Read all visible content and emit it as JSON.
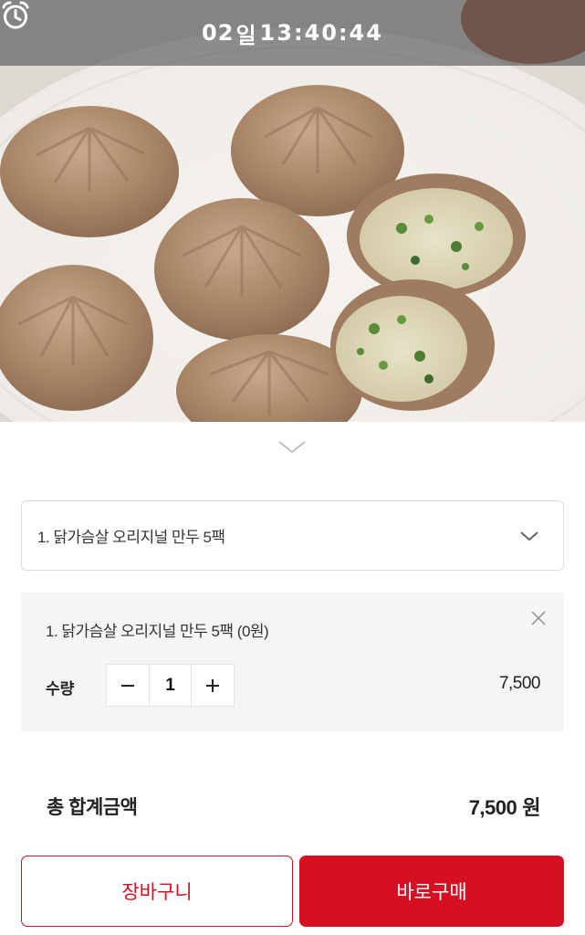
{
  "timer": {
    "icon": "alarm-clock-icon",
    "day": "02",
    "day_unit": "일",
    "time": "13:40:44"
  },
  "product_image": {
    "icon": "product-photo-dumplings"
  },
  "collapse": {
    "icon": "chevron-down-icon"
  },
  "option_select": {
    "selected_label": "1. 닭가슴살 오리지널 만두 5팩",
    "icon": "chevron-down-icon"
  },
  "selected_option": {
    "name": "1. 닭가슴살 오리지널 만두 5팩 (0원)",
    "remove_icon": "close-icon",
    "quantity_label": "수량",
    "quantity": "1",
    "decrement": "−",
    "increment": "+",
    "price": "7,500"
  },
  "total": {
    "label": "총 합계금액",
    "amount": "7,500",
    "currency": "원"
  },
  "actions": {
    "cart_label": "장바구니",
    "buy_label": "바로구매"
  },
  "colors": {
    "accent": "#d70f22",
    "option_bg": "#f5f5f5",
    "timer_overlay": "rgba(80,80,80,0.62)"
  }
}
